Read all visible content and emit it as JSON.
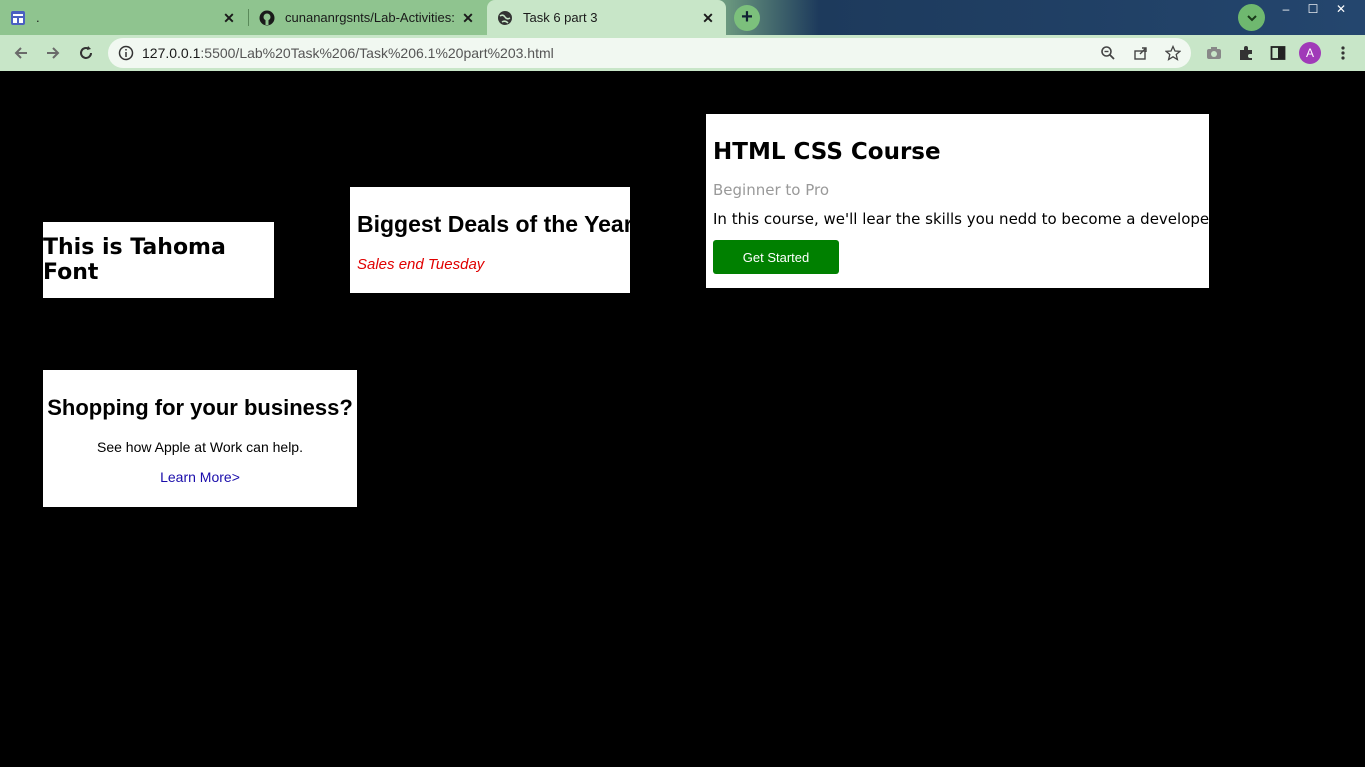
{
  "browser": {
    "tabs": [
      {
        "title": ".",
        "favicon": "calendar-icon",
        "active": false
      },
      {
        "title": "cunananrgsnts/Lab-Activities:",
        "favicon": "github-icon",
        "active": false
      },
      {
        "title": "Task 6 part 3",
        "favicon": "globe-icon",
        "active": true
      }
    ],
    "address": {
      "host": "127.0.0.1",
      "path": ":5500/Lab%20Task%206/Task%206.1%20part%203.html"
    },
    "avatar_letter": "A",
    "colors": {
      "chrome": "#c8e6c8",
      "tab_inactive": "#8fc48f",
      "avatar": "#a03ab8"
    }
  },
  "page": {
    "background": "#000000",
    "tahoma_card": {
      "heading": "This is Tahoma Font"
    },
    "deals_card": {
      "heading": "Biggest Deals of the Year!",
      "note": "Sales end Tuesday",
      "note_color": "#e00000"
    },
    "course_card": {
      "heading": "HTML CSS Course",
      "subtitle": "Beginner to Pro",
      "description": "In this course, we'll lear the skills you nedd to become a developer.",
      "button_label": "Get Started",
      "button_color": "#008000"
    },
    "shop_card": {
      "heading": "Shopping for your business?",
      "text": "See how Apple at Work can help.",
      "link": "Learn More>"
    }
  }
}
